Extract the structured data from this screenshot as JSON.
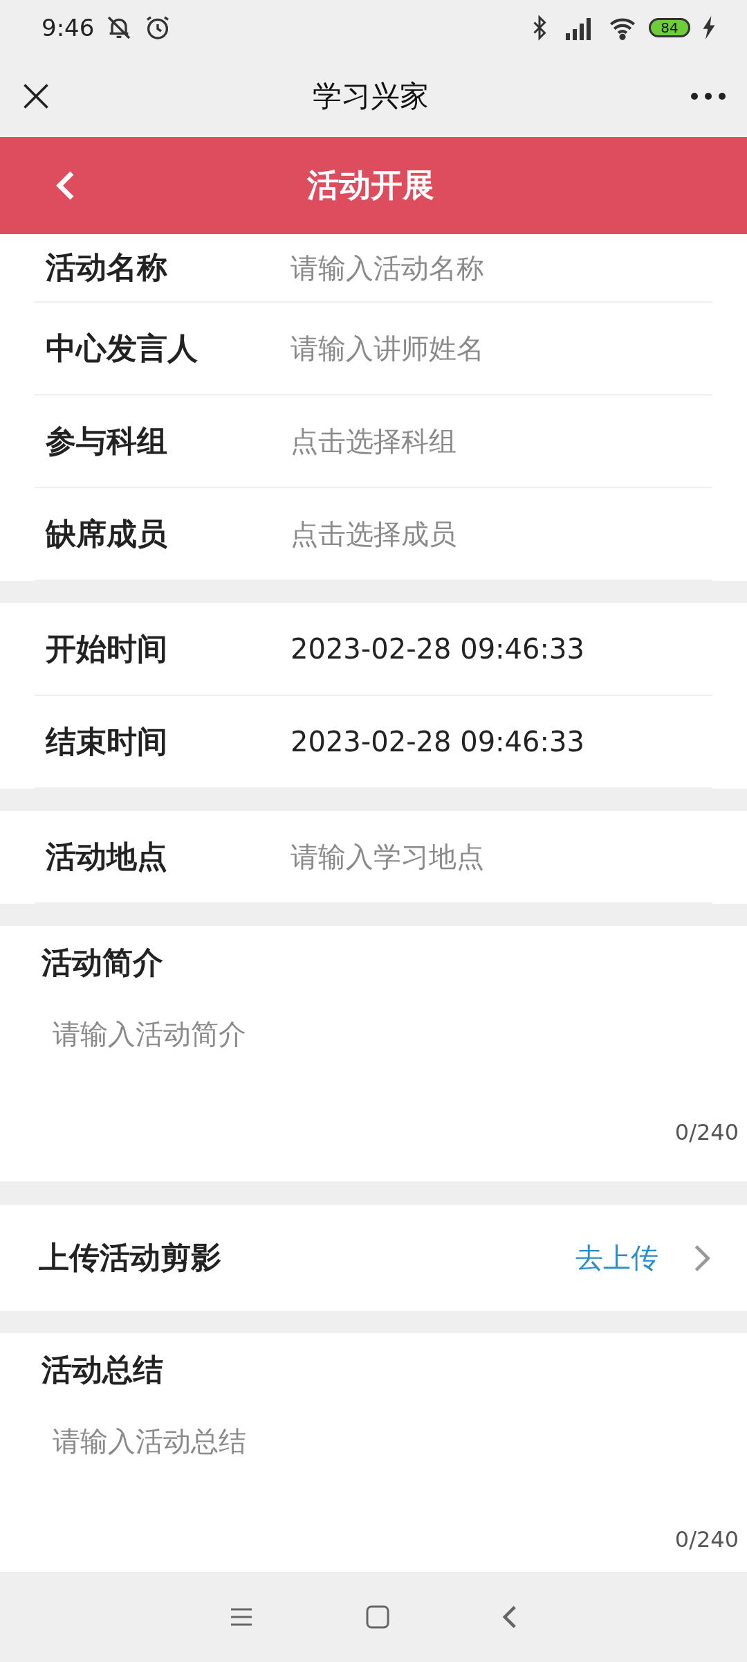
{
  "status_bar": {
    "time": "9:46",
    "battery": "84"
  },
  "nav_bar": {
    "title": "学习兴家"
  },
  "header": {
    "title": "活动开展"
  },
  "groups": [
    {
      "rows": [
        {
          "label": "活动名称",
          "placeholder": "请输入活动名称"
        },
        {
          "label": "中心发言人",
          "placeholder": "请输入讲师姓名"
        },
        {
          "label": "参与科组",
          "placeholder": "点击选择科组"
        },
        {
          "label": "缺席成员",
          "placeholder": "点击选择成员"
        }
      ]
    },
    {
      "rows": [
        {
          "label": "开始时间",
          "value": "2023-02-28 09:46:33"
        },
        {
          "label": "结束时间",
          "value": "2023-02-28 09:46:33"
        }
      ]
    },
    {
      "rows": [
        {
          "label": "活动地点",
          "placeholder": "请输入学习地点"
        }
      ]
    }
  ],
  "intro": {
    "title": "活动简介",
    "placeholder": "请输入活动简介",
    "count": "0/240"
  },
  "upload": {
    "label": "上传活动剪影",
    "action": "去上传"
  },
  "summary": {
    "title": "活动总结",
    "placeholder": "请输入活动总结",
    "count": "0/240"
  }
}
